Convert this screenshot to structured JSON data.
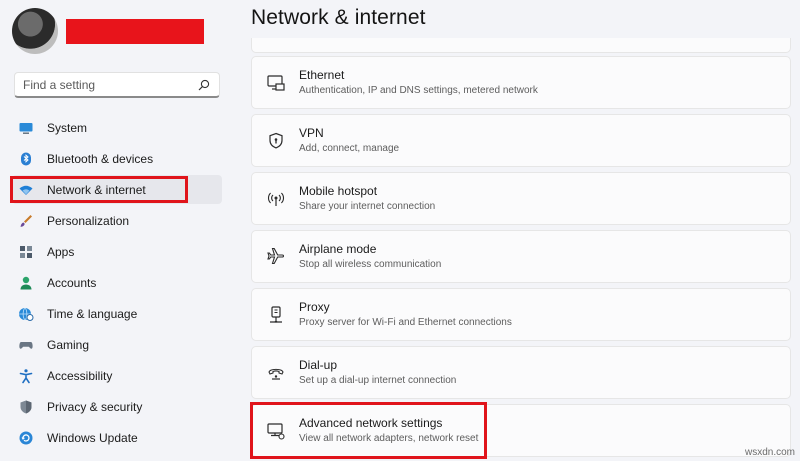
{
  "page": {
    "title": "Network & internet"
  },
  "search": {
    "placeholder": "Find a setting",
    "value": ""
  },
  "sidebar": {
    "items": [
      {
        "label": "System",
        "icon": "monitor-icon",
        "active": false
      },
      {
        "label": "Bluetooth & devices",
        "icon": "bluetooth-icon",
        "active": false
      },
      {
        "label": "Network & internet",
        "icon": "wifi-icon",
        "active": true
      },
      {
        "label": "Personalization",
        "icon": "brush-icon",
        "active": false
      },
      {
        "label": "Apps",
        "icon": "apps-icon",
        "active": false
      },
      {
        "label": "Accounts",
        "icon": "person-icon",
        "active": false
      },
      {
        "label": "Time & language",
        "icon": "globe-clock-icon",
        "active": false
      },
      {
        "label": "Gaming",
        "icon": "gamepad-icon",
        "active": false
      },
      {
        "label": "Accessibility",
        "icon": "accessibility-icon",
        "active": false
      },
      {
        "label": "Privacy & security",
        "icon": "shield-icon",
        "active": false
      },
      {
        "label": "Windows Update",
        "icon": "update-icon",
        "active": false
      }
    ]
  },
  "settings": {
    "items": [
      {
        "title": "Ethernet",
        "subtitle": "Authentication, IP and DNS settings, metered network",
        "icon": "ethernet-icon"
      },
      {
        "title": "VPN",
        "subtitle": "Add, connect, manage",
        "icon": "vpn-shield-icon"
      },
      {
        "title": "Mobile hotspot",
        "subtitle": "Share your internet connection",
        "icon": "hotspot-icon"
      },
      {
        "title": "Airplane mode",
        "subtitle": "Stop all wireless communication",
        "icon": "airplane-icon"
      },
      {
        "title": "Proxy",
        "subtitle": "Proxy server for Wi-Fi and Ethernet connections",
        "icon": "proxy-icon"
      },
      {
        "title": "Dial-up",
        "subtitle": "Set up a dial-up internet connection",
        "icon": "dialup-icon"
      },
      {
        "title": "Advanced network settings",
        "subtitle": "View all network adapters, network reset",
        "icon": "advanced-network-icon"
      }
    ]
  },
  "watermark": "wsxdn.com",
  "colors": {
    "highlight": "#e0141b",
    "accent": "#0067c0",
    "background": "#f3f4f8"
  }
}
